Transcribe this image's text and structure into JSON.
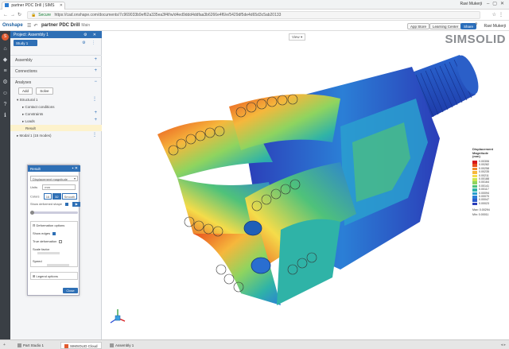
{
  "browser": {
    "tab_title": "partner PDC Drill | SIMS",
    "user_name": "Ravi Mukerji",
    "secure_label": "Secure",
    "url": "https://cad.onshape.com/documents/7c969033b9ef62a335ea3f4f/w/d4ed9ddd4ddfaa3b6266e4f6/e/5429df5de4d65d3c5ab20133"
  },
  "app": {
    "logo": "Onshape",
    "doc_title": "partner PDC Drill",
    "branch": "Main",
    "app_store": "App Store",
    "learning_center": "Learning Center",
    "share": "Share",
    "user_menu": "Ravi Mukerji"
  },
  "panel": {
    "project_title": "Project: Assembly 1",
    "study_tab": "Study 1",
    "sections": [
      "Assembly",
      "Connections",
      "Analyses"
    ],
    "actions": [
      "Add",
      "Solve"
    ],
    "tree": [
      {
        "label": "▾ Structural 1",
        "indent": 0
      },
      {
        "label": "▸ Contact conditions",
        "indent": 1
      },
      {
        "label": "▸ Constraints",
        "indent": 1
      },
      {
        "label": "▸ Loads",
        "indent": 1
      },
      {
        "label": "Result",
        "indent": 1
      },
      {
        "label": "▸ Modal 1 (15 modes)",
        "indent": 0
      }
    ]
  },
  "result_dialog": {
    "title": "Result",
    "type": "Displacement magnitude",
    "units_label": "Units",
    "units_value": "mm",
    "scale_label": "Colors",
    "scale_options": [
      "16",
      "32",
      "Smooth"
    ],
    "scale_active": "32",
    "show_deformed": "Show deformed shape",
    "deformation_options": "Deformation options",
    "show_edges": "Show edges",
    "true_deformation": "True deformation",
    "scale_factor": "Scale factor",
    "speed": "Speed",
    "legend_options": "Legend options",
    "close": "Close"
  },
  "canvas": {
    "brand": "SIMSOLID",
    "view_menu": "View"
  },
  "legend": {
    "title_line1": "Displacement",
    "title_line2": "Magnitude",
    "title_line3": "(mm)",
    "colors": [
      "#d7191c",
      "#e8521e",
      "#f08a2a",
      "#f6b73c",
      "#f5dc4a",
      "#cde651",
      "#8fd45f",
      "#4fc27a",
      "#2fb3a7",
      "#2a9fcf",
      "#2b7fd6",
      "#2d5ccc",
      "#2b3db8"
    ],
    "values": [
      "0.00306",
      "0.00282",
      "0.00258",
      "0.00235",
      "0.00211",
      "0.00188",
      "0.00164",
      "0.00141",
      "0.00117",
      "0.00094",
      "0.00070",
      "0.00047",
      "0.00023"
    ],
    "max_label": "Max: 0.00294",
    "min_label": "Min: 0.00011"
  },
  "taskbar": {
    "items": [
      "Part Studio 1",
      "SIMSOLID Cloud",
      "Assembly 1"
    ],
    "active": "SIMSOLID Cloud"
  }
}
